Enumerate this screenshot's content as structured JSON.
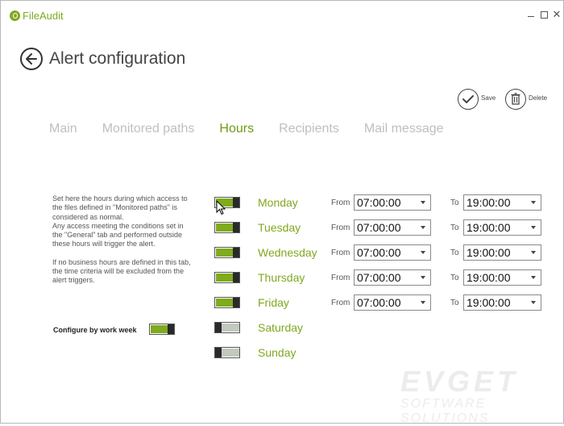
{
  "app": {
    "title": "FileAudit"
  },
  "header": {
    "title": "Alert configuration"
  },
  "actions": {
    "save_label": "Save",
    "delete_label": "Delete"
  },
  "tabs": [
    {
      "label": "Main",
      "active": false
    },
    {
      "label": "Monitored paths",
      "active": false
    },
    {
      "label": "Hours",
      "active": true
    },
    {
      "label": "Recipients",
      "active": false
    },
    {
      "label": "Mail message",
      "active": false
    }
  ],
  "description": {
    "para1": "Set here the hours during which access to the files defined in \"Monitored paths\" is considered as normal.\nAny access meeting the conditions set in the \"General\" tab and performed outside these hours will trigger the alert.",
    "para2": "If no business hours are defined in this tab, the time criteria will be excluded from the alert triggers."
  },
  "configure_work_week": {
    "label": "Configure by work week",
    "enabled": true
  },
  "from_label": "From",
  "to_label": "To",
  "days": [
    {
      "name": "Monday",
      "enabled": true,
      "from": "07:00:00",
      "to": "19:00:00"
    },
    {
      "name": "Tuesday",
      "enabled": true,
      "from": "07:00:00",
      "to": "19:00:00"
    },
    {
      "name": "Wednesday",
      "enabled": true,
      "from": "07:00:00",
      "to": "19:00:00"
    },
    {
      "name": "Thursday",
      "enabled": true,
      "from": "07:00:00",
      "to": "19:00:00"
    },
    {
      "name": "Friday",
      "enabled": true,
      "from": "07:00:00",
      "to": "19:00:00"
    },
    {
      "name": "Saturday",
      "enabled": false
    },
    {
      "name": "Sunday",
      "enabled": false
    }
  ],
  "watermark": {
    "line1": "EVGET",
    "line2": "SOFTWARE SOLUTIONS"
  },
  "colors": {
    "accent": "#7fa81f",
    "tab_active": "#6f9b13",
    "tab_inactive": "#bfbfbf"
  }
}
